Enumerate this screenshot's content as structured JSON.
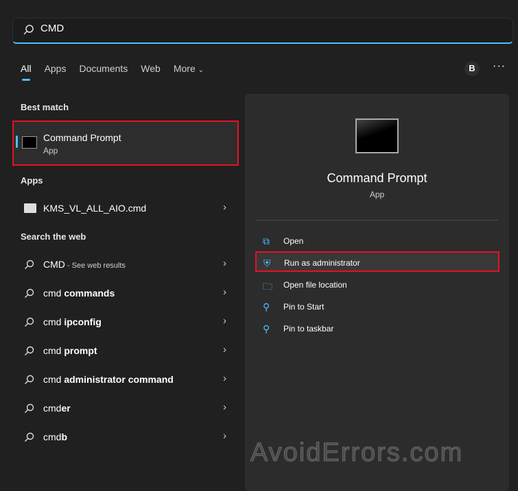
{
  "search": {
    "value": "CMD"
  },
  "tabs": [
    "All",
    "Apps",
    "Documents",
    "Web",
    "More"
  ],
  "avatar": "B",
  "more_menu": "···",
  "sections": {
    "best_match": "Best match",
    "apps": "Apps",
    "web": "Search the web"
  },
  "best_match": {
    "title": "Command Prompt",
    "subtitle": "App"
  },
  "apps": [
    {
      "label": "KMS_VL_ALL_AIO.cmd"
    }
  ],
  "web_results": [
    {
      "prefix": "CMD",
      "bold": "",
      "note": " - See web results"
    },
    {
      "prefix": "cmd ",
      "bold": "commands",
      "note": ""
    },
    {
      "prefix": "cmd ",
      "bold": "ipconfig",
      "note": ""
    },
    {
      "prefix": "cmd ",
      "bold": "prompt",
      "note": ""
    },
    {
      "prefix": "cmd ",
      "bold": "administrator command",
      "note": ""
    },
    {
      "prefix": "cmd",
      "bold": "er",
      "note": ""
    },
    {
      "prefix": "cmd",
      "bold": "b",
      "note": ""
    }
  ],
  "detail": {
    "title": "Command Prompt",
    "subtitle": "App",
    "actions": [
      {
        "label": "Open",
        "icon": "open-external-icon"
      },
      {
        "label": "Run as administrator",
        "icon": "shield-window-icon"
      },
      {
        "label": "Open file location",
        "icon": "folder-icon"
      },
      {
        "label": "Pin to Start",
        "icon": "pin-icon"
      },
      {
        "label": "Pin to taskbar",
        "icon": "pin-icon"
      }
    ]
  },
  "watermark": "AvoidErrors.com",
  "colors": {
    "accent": "#4cc2ff",
    "highlight": "#e81123"
  }
}
